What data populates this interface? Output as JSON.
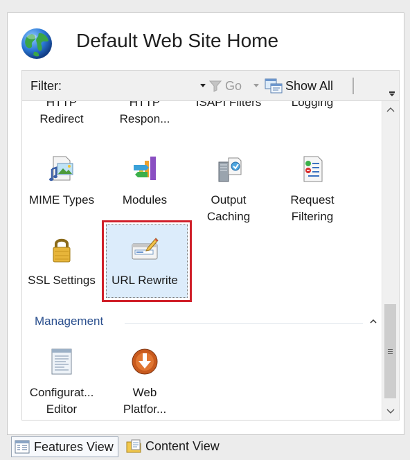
{
  "header": {
    "title": "Default Web Site Home",
    "icon": "globe-icon"
  },
  "toolbar": {
    "filter_label": "Filter:",
    "go_label": "Go",
    "show_all_label": "Show All"
  },
  "features": {
    "row0": [
      {
        "line1": "HTTP",
        "line2": "Redirect"
      },
      {
        "line1": "HTTP",
        "line2": "Respon..."
      },
      {
        "line1": "ISAPI Filters",
        "line2": ""
      },
      {
        "line1": "Logging",
        "line2": ""
      }
    ],
    "row1": [
      {
        "line1": "MIME Types",
        "line2": "",
        "icon": "mime-types-icon"
      },
      {
        "line1": "Modules",
        "line2": "",
        "icon": "modules-icon"
      },
      {
        "line1": "Output",
        "line2": "Caching",
        "icon": "output-caching-icon"
      },
      {
        "line1": "Request",
        "line2": "Filtering",
        "icon": "request-filtering-icon"
      }
    ],
    "row2": [
      {
        "line1": "SSL Settings",
        "line2": "",
        "icon": "lock-icon"
      },
      {
        "line1": "URL Rewrite",
        "line2": "",
        "icon": "url-rewrite-icon",
        "selected": true
      }
    ]
  },
  "management": {
    "title": "Management",
    "items": [
      {
        "line1": "Configurat...",
        "line2": "Editor",
        "icon": "configuration-editor-icon"
      },
      {
        "line1": "Web",
        "line2": "Platfor...",
        "icon": "web-platform-installer-icon"
      }
    ]
  },
  "bottom_tabs": {
    "features_view": "Features View",
    "content_view": "Content View"
  },
  "colors": {
    "selection_border": "#d0202a",
    "selection_fill": "#dcecfb",
    "group_title": "#2a4f8e"
  }
}
